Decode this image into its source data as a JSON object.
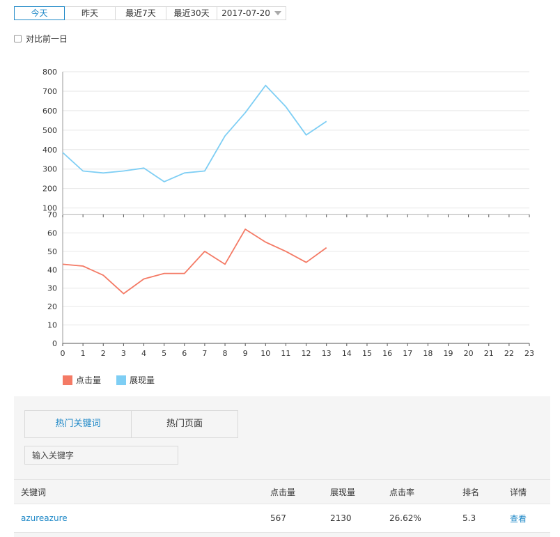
{
  "range_tabs": [
    {
      "label": "今天",
      "active": true
    },
    {
      "label": "昨天",
      "active": false
    },
    {
      "label": "最近7天",
      "active": false
    },
    {
      "label": "最近30天",
      "active": false
    }
  ],
  "date_select": {
    "value": "2017-07-20"
  },
  "compare": {
    "label": "对比前一日",
    "checked": false
  },
  "chart_data": {
    "type": "line",
    "x": [
      0,
      1,
      2,
      3,
      4,
      5,
      6,
      7,
      8,
      9,
      10,
      11,
      12,
      13,
      14,
      15,
      16,
      17,
      18,
      19,
      20,
      21,
      22,
      23
    ],
    "upper_panel": {
      "series": [
        {
          "name": "展现量",
          "color": "#7ecef4",
          "values": [
            385,
            290,
            280,
            290,
            305,
            235,
            280,
            290,
            470,
            590,
            730,
            620,
            475,
            545
          ]
        }
      ],
      "ylim": [
        70,
        800
      ],
      "yticks": [
        70,
        100,
        200,
        300,
        400,
        500,
        600,
        700,
        800
      ]
    },
    "lower_panel": {
      "series": [
        {
          "name": "点击量",
          "color": "#f47a65",
          "values": [
            43,
            42,
            37,
            27,
            35,
            38,
            38,
            50,
            43,
            62,
            55,
            50,
            44,
            52
          ]
        }
      ],
      "ylim": [
        0,
        70
      ],
      "yticks": [
        0,
        10,
        20,
        30,
        40,
        50,
        60,
        70
      ]
    },
    "grid": true,
    "legend_placement": "bottom-left"
  },
  "legend": [
    {
      "name": "点击量",
      "color": "#f47a65"
    },
    {
      "name": "展现量",
      "color": "#7ecef4"
    }
  ],
  "panel": {
    "tabs": [
      {
        "label": "热门关键词",
        "active": true
      },
      {
        "label": "热门页面",
        "active": false
      }
    ],
    "search_placeholder": "输入关键字",
    "table": {
      "headers": [
        "关键词",
        "点击量",
        "展现量",
        "点击率",
        "排名",
        "详情"
      ],
      "rows": [
        {
          "keyword": "azureazure",
          "clicks": "567",
          "impressions": "2130",
          "ctr": "26.62%",
          "rank": "5.3",
          "detail": "查看"
        }
      ]
    }
  }
}
